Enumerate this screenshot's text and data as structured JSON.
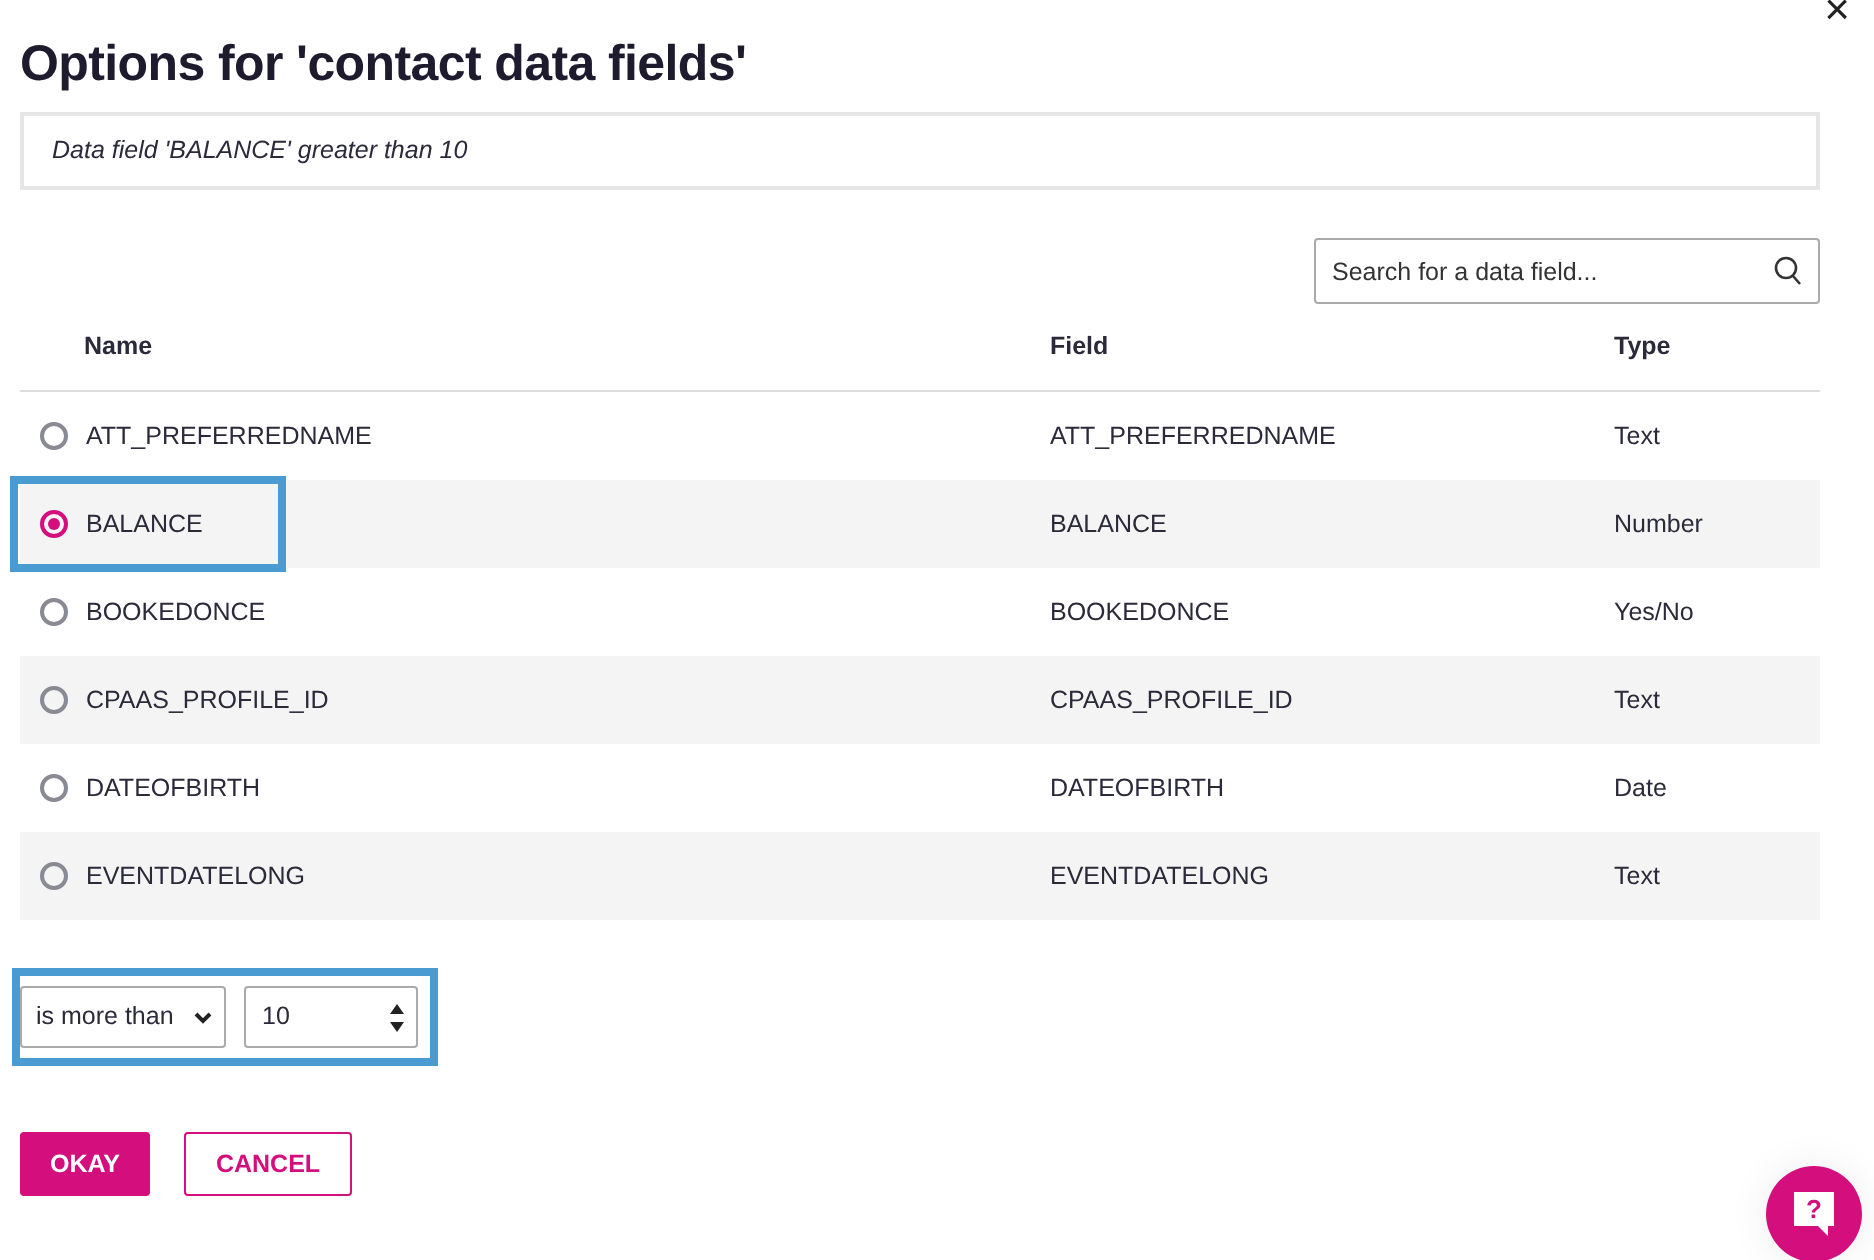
{
  "dialog": {
    "title": "Options for 'contact data fields'",
    "close": "×",
    "summary": "Data field 'BALANCE' greater than 10"
  },
  "search": {
    "placeholder": "Search for a data field..."
  },
  "table": {
    "columns": [
      "Name",
      "Field",
      "Type"
    ],
    "rows": [
      {
        "name": "ATT_PREFERREDNAME",
        "field": "ATT_PREFERREDNAME",
        "type": "Text",
        "selected": false,
        "highlighted": false
      },
      {
        "name": "BALANCE",
        "field": "BALANCE",
        "type": "Number",
        "selected": true,
        "highlighted": true
      },
      {
        "name": "BOOKEDONCE",
        "field": "BOOKEDONCE",
        "type": "Yes/No",
        "selected": false,
        "highlighted": false
      },
      {
        "name": "CPAAS_PROFILE_ID",
        "field": "CPAAS_PROFILE_ID",
        "type": "Text",
        "selected": false,
        "highlighted": false
      },
      {
        "name": "DATEOFBIRTH",
        "field": "DATEOFBIRTH",
        "type": "Date",
        "selected": false,
        "highlighted": false
      },
      {
        "name": "EVENTDATELONG",
        "field": "EVENTDATELONG",
        "type": "Text",
        "selected": false,
        "highlighted": false
      }
    ]
  },
  "condition": {
    "operator": "is more than",
    "value": "10",
    "highlighted": true
  },
  "buttons": [
    {
      "label": "OKAY",
      "kind": "primary"
    },
    {
      "label": "CANCEL",
      "kind": "outline"
    }
  ],
  "help": {
    "label": "?"
  }
}
